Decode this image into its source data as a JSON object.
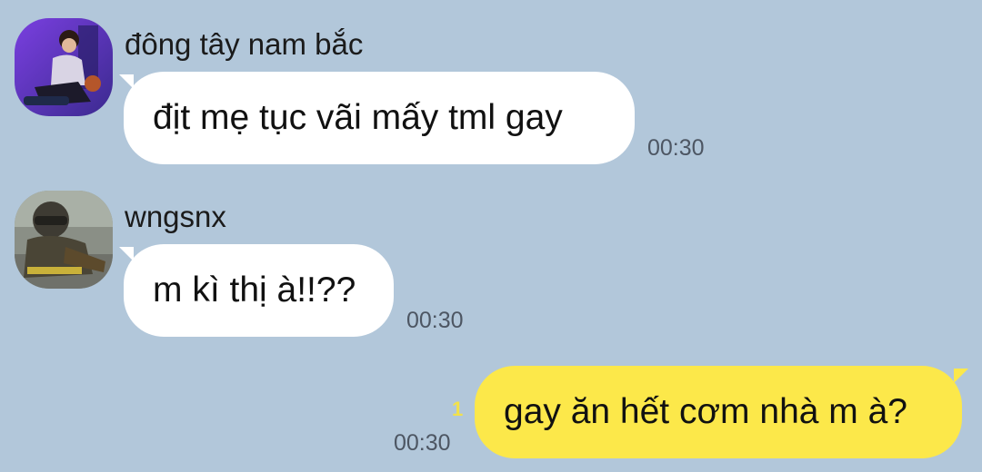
{
  "chat": {
    "messages": [
      {
        "sender": "đông tây nam bắc",
        "text": "địt mẹ tục vãi mấy tml gay",
        "time": "00:30",
        "direction": "incoming",
        "avatar_icon": "person-with-basketball-avatar"
      },
      {
        "sender": "wngsnx",
        "text": "m kì thị à!!??",
        "time": "00:30",
        "direction": "incoming",
        "avatar_icon": "helmet-rider-avatar"
      },
      {
        "text": "gay ăn hết cơm nhà m à?",
        "time": "00:30",
        "unread": "1",
        "direction": "outgoing"
      }
    ]
  },
  "colors": {
    "background": "#b2c7da",
    "incoming_bubble": "#ffffff",
    "outgoing_bubble": "#fce84a",
    "unread_count": "#f2e14a",
    "timestamp": "#4d5663"
  }
}
